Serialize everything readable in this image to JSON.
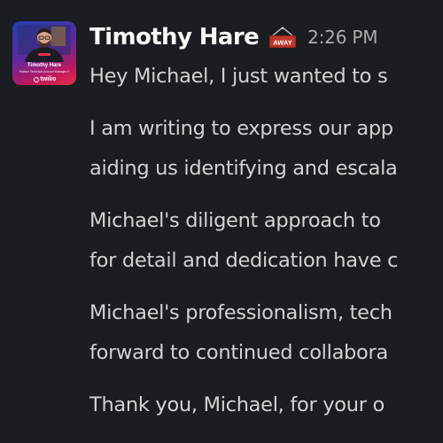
{
  "message": {
    "sender": {
      "name": "Timothy Hare",
      "status_badge": "AWAY",
      "timestamp": "2:26 PM",
      "avatar": {
        "card_name": "Timothy Hare",
        "card_role": "Partner Technical Account Manager II",
        "brand": "twilio",
        "gradient_colors": [
          "#1f3fae",
          "#5c2aa0",
          "#c2185b",
          "#e5304a"
        ]
      }
    },
    "paragraphs": [
      {
        "lines": [
          "Hey Michael, I just wanted to s"
        ]
      },
      {
        "lines": [
          "I am writing to express our app",
          "aiding us identifying and escala"
        ]
      },
      {
        "lines": [
          "Michael's diligent approach to",
          "for detail and dedication have c"
        ]
      },
      {
        "lines": [
          "Michael's professionalism, tech",
          "forward to continued collabora"
        ]
      },
      {
        "lines": [
          "Thank you, Michael, for your o"
        ]
      }
    ]
  },
  "theme": {
    "background": "#1a1d21",
    "name_color": "#f8f8f8",
    "text_color": "#d1d2d3",
    "timestamp_color": "#ababad",
    "away_badge_color": "#e01e5a"
  }
}
